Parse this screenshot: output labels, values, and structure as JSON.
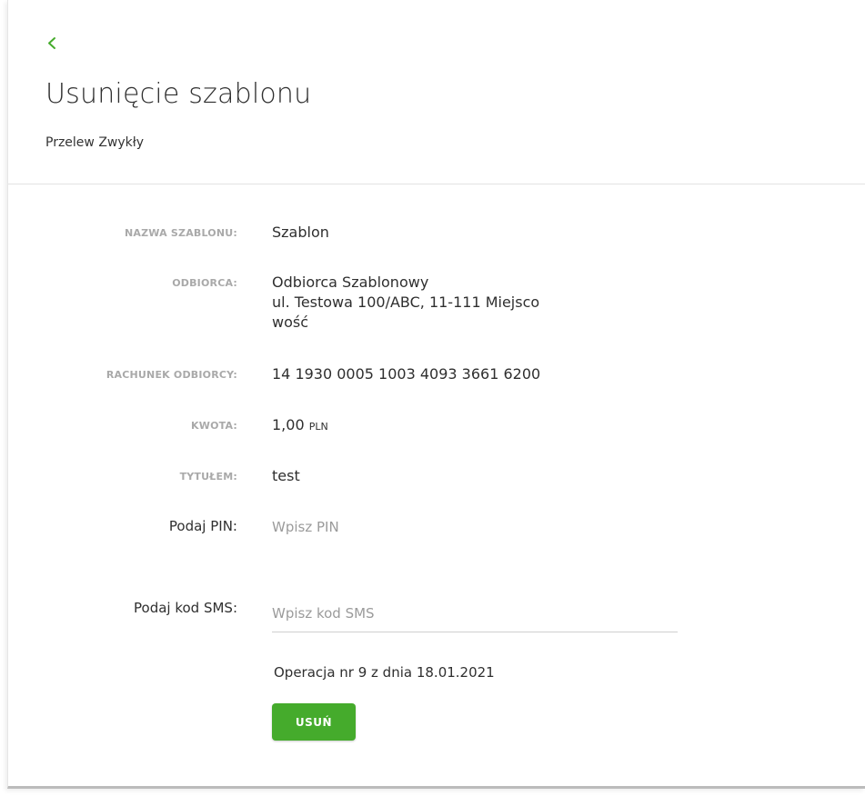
{
  "header": {
    "title": "Usunięcie szablonu",
    "subtitle": "Przelew Zwykły"
  },
  "details": [
    {
      "label": "NAZWA SZABLONU:",
      "lines": [
        "Szablon"
      ]
    },
    {
      "label": "ODBIORCA:",
      "lines": [
        "Odbiorca Szablonowy",
        "ul. Testowa 100/ABC, 11-111 Miejsco",
        "wość"
      ]
    },
    {
      "label": "RACHUNEK ODBIORCY:",
      "lines": [
        "14 1930 0005 1003 4093 3661 6200"
      ]
    },
    {
      "label": "KWOTA:",
      "amount": "1,00",
      "currency": "PLN"
    },
    {
      "label": "TYTUŁEM:",
      "lines": [
        "test"
      ]
    }
  ],
  "pin": {
    "label": "Podaj PIN:",
    "placeholder": "Wpisz PIN",
    "value": ""
  },
  "sms": {
    "label": "Podaj kod SMS:",
    "placeholder": "Wpisz kod SMS",
    "value": ""
  },
  "operation_text": "Operacja nr 9 z dnia 18.01.2021",
  "delete_button": "USUŃ",
  "colors": {
    "accent": "#45ab2c",
    "label": "#a9a9a9",
    "text": "#2f2f2f"
  }
}
